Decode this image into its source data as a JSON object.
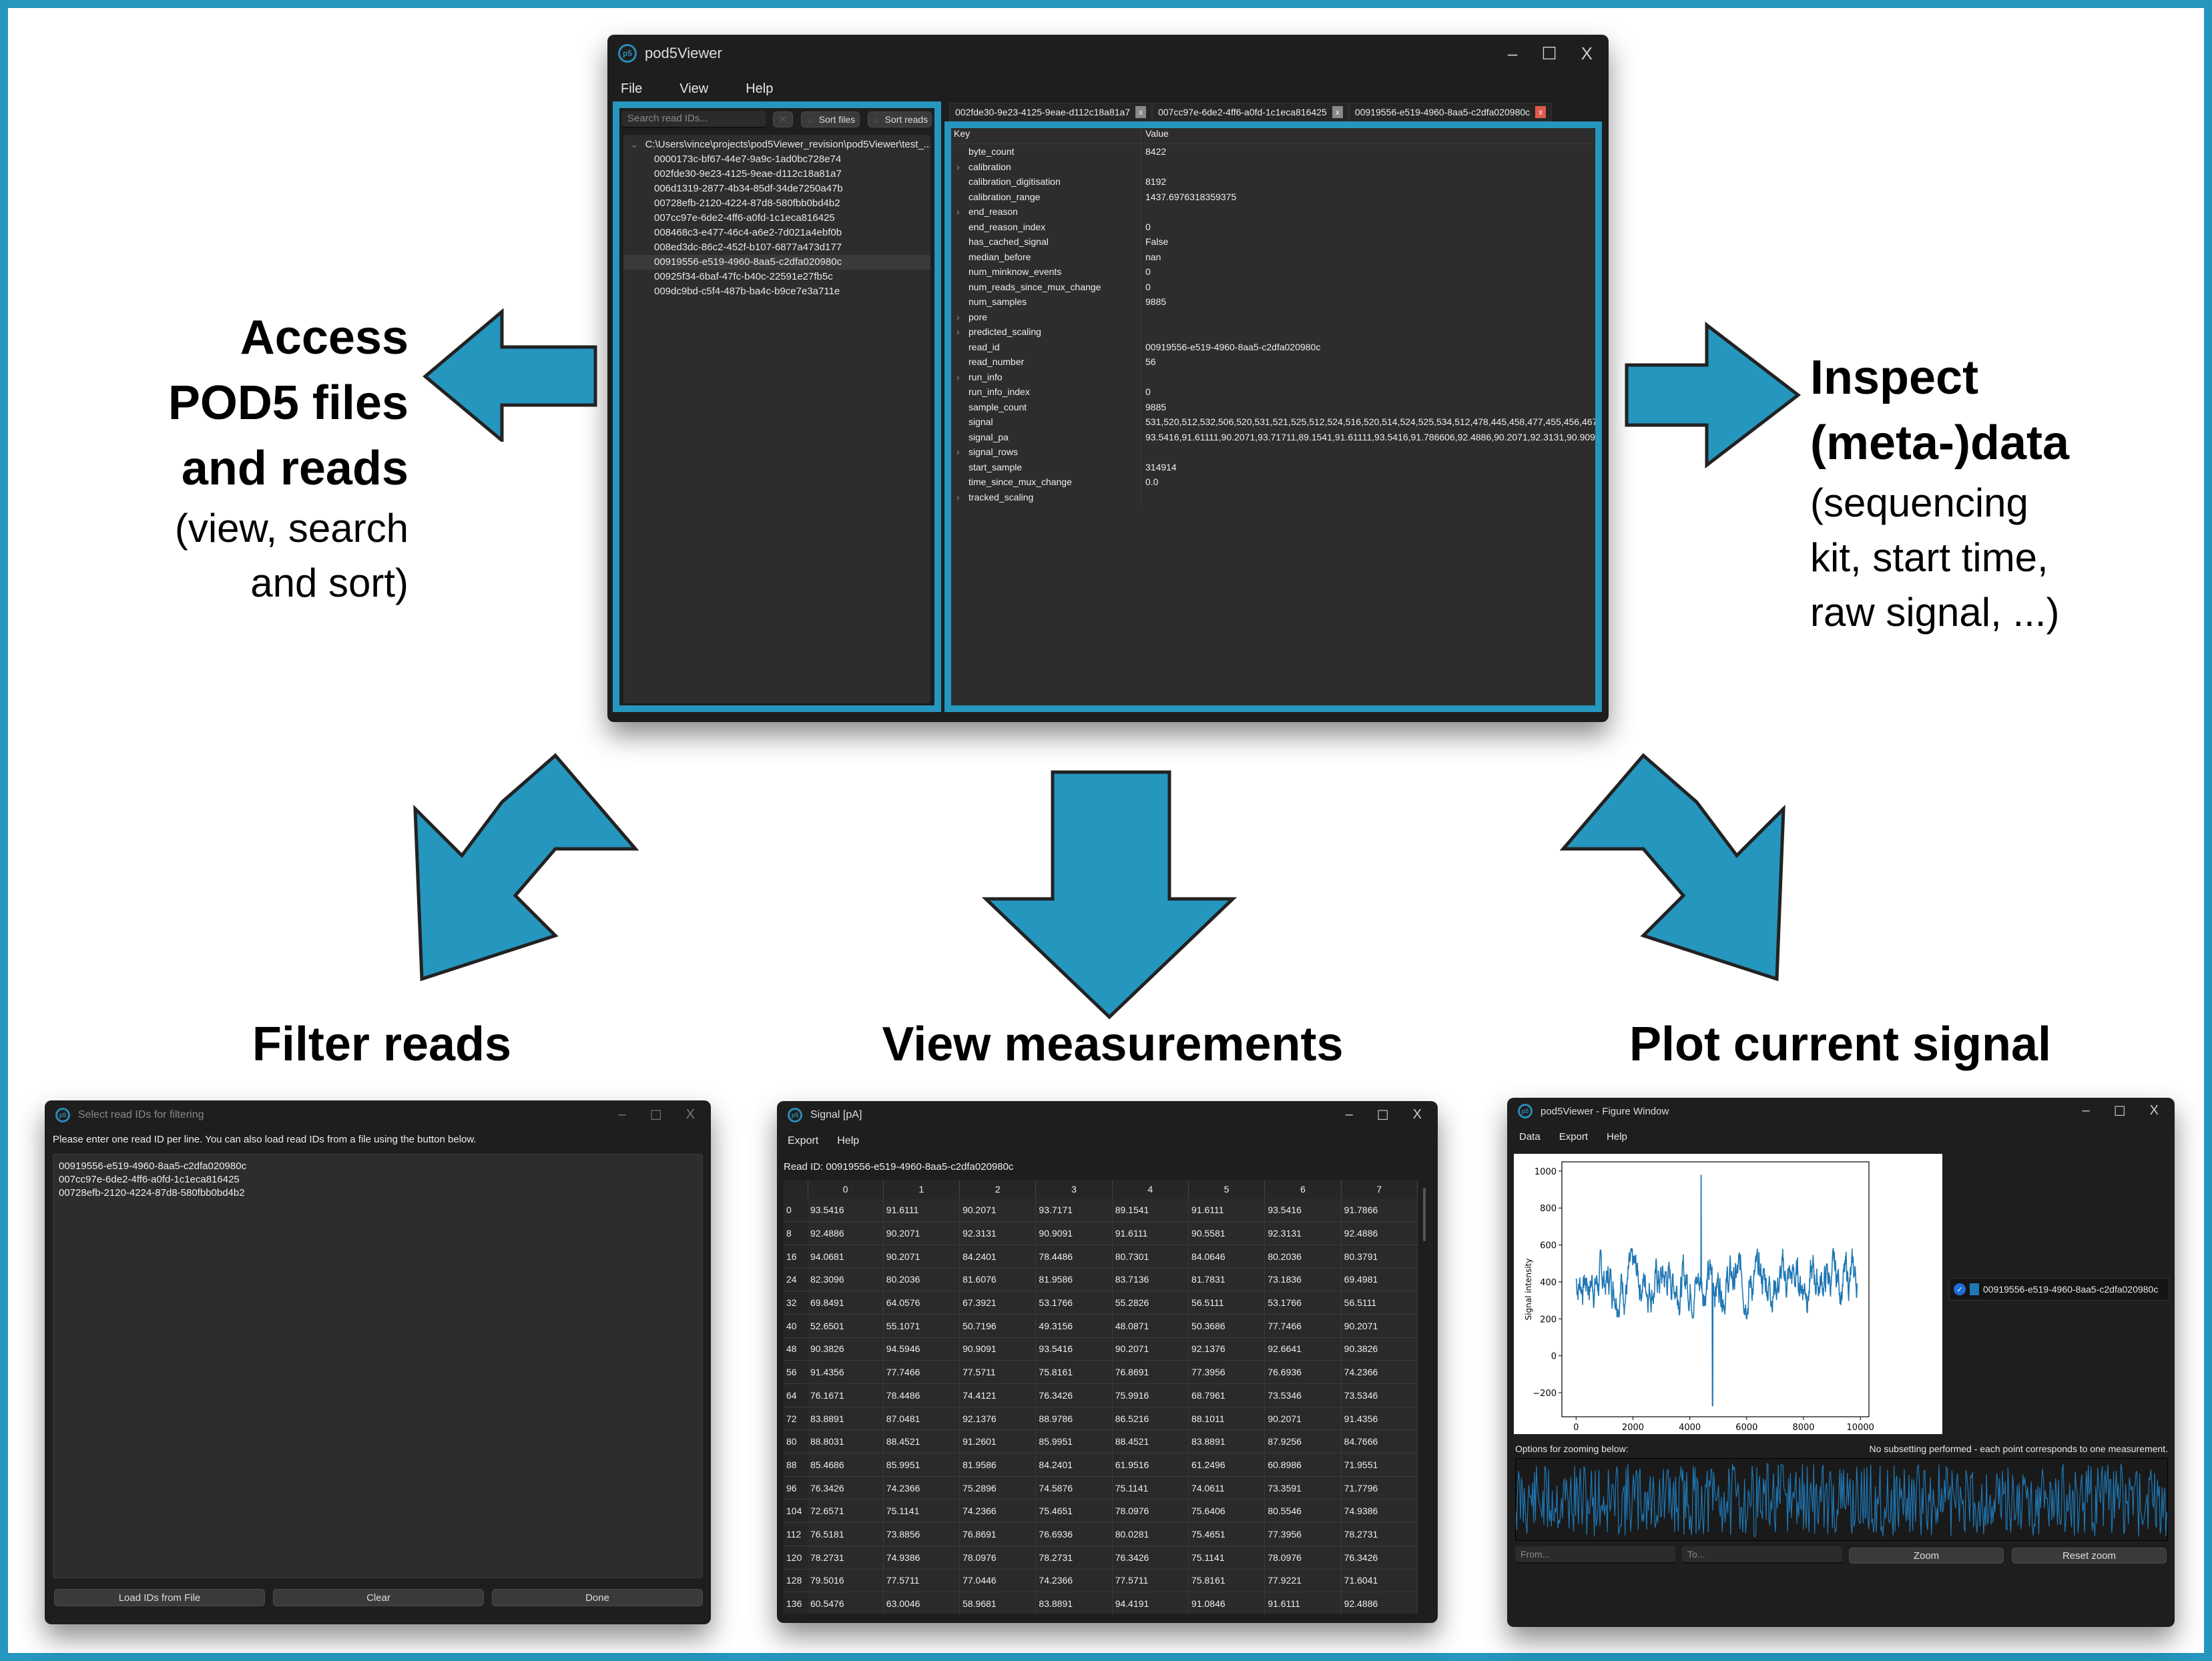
{
  "annotations": {
    "access": {
      "title": [
        "Access",
        "POD5 files",
        "and reads"
      ],
      "subtitle": [
        "(view, search",
        "and sort)"
      ]
    },
    "inspect": {
      "title": [
        "Inspect",
        "(meta-)data"
      ],
      "subtitle": [
        "(sequencing",
        "kit, start time,",
        "raw signal, ...)"
      ]
    },
    "captions": {
      "filter": "Filter reads",
      "measurements": "View measurements",
      "plot": "Plot current signal"
    }
  },
  "colors": {
    "accent": "#2596be",
    "window_bg": "#1e1e1e",
    "pane_bg": "#2d2d2d",
    "plot_line": "#1f77b4",
    "active_tab_close": "#e05a4a"
  },
  "main_window": {
    "title": "pod5Viewer",
    "menu": [
      "File",
      "View",
      "Help"
    ],
    "window_controls": {
      "minimize": "–",
      "maximize": "☐",
      "close": "X"
    },
    "search_placeholder": "Search read IDs...",
    "clear_search_icon": "✕",
    "sort_files_label": "Sort files",
    "sort_reads_label": "Sort reads",
    "file_path": "C:\\Users\\vince\\projects\\pod5Viewer_revision\\pod5Viewer\\test_...",
    "read_ids": [
      "0000173c-bf67-44e7-9a9c-1ad0bc728e74",
      "002fde30-9e23-4125-9eae-d112c18a81a7",
      "006d1319-2877-4b34-85df-34de7250a47b",
      "00728efb-2120-4224-87d8-580fbb0bd4b2",
      "007cc97e-6de2-4ff6-a0fd-1c1eca816425",
      "008468c3-e477-46c4-a6e2-7d021a4ebf0b",
      "008ed3dc-86c2-452f-b107-6877a473d177",
      "00919556-e519-4960-8aa5-c2dfa020980c",
      "00925f34-6baf-47fc-b40c-22591e27fb5c",
      "009dc9bd-c5f4-487b-ba4c-b9ce7e3a711e"
    ],
    "selected_read_index": 7,
    "tabs": [
      {
        "label": "002fde30-9e23-4125-9eae-d112c18a81a7",
        "active": false
      },
      {
        "label": "007cc97e-6de2-4ff6-a0fd-1c1eca816425",
        "active": false
      },
      {
        "label": "00919556-e519-4960-8aa5-c2dfa020980c",
        "active": true
      }
    ],
    "tab_close_label": "x",
    "kv_headers": {
      "key": "Key",
      "value": "Value"
    },
    "kv_rows": [
      {
        "key": "byte_count",
        "value": "8422",
        "expandable": false
      },
      {
        "key": "calibration",
        "value": "",
        "expandable": true
      },
      {
        "key": "calibration_digitisation",
        "value": "8192",
        "expandable": false
      },
      {
        "key": "calibration_range",
        "value": "1437.6976318359375",
        "expandable": false
      },
      {
        "key": "end_reason",
        "value": "",
        "expandable": true
      },
      {
        "key": "end_reason_index",
        "value": "0",
        "expandable": false
      },
      {
        "key": "has_cached_signal",
        "value": "False",
        "expandable": false
      },
      {
        "key": "median_before",
        "value": "nan",
        "expandable": false
      },
      {
        "key": "num_minknow_events",
        "value": "0",
        "expandable": false
      },
      {
        "key": "num_reads_since_mux_change",
        "value": "0",
        "expandable": false
      },
      {
        "key": "num_samples",
        "value": "9885",
        "expandable": false
      },
      {
        "key": "pore",
        "value": "",
        "expandable": true
      },
      {
        "key": "predicted_scaling",
        "value": "",
        "expandable": true
      },
      {
        "key": "read_id",
        "value": "00919556-e519-4960-8aa5-c2dfa020980c",
        "expandable": false
      },
      {
        "key": "read_number",
        "value": "56",
        "expandable": false
      },
      {
        "key": "run_info",
        "value": "",
        "expandable": true
      },
      {
        "key": "run_info_index",
        "value": "0",
        "expandable": false
      },
      {
        "key": "sample_count",
        "value": "9885",
        "expandable": false
      },
      {
        "key": "signal",
        "value": "531,520,512,532,506,520,531,521,525,512,524,516,520,514,524,525,534,512,478,445,458,477,455,456,467,...",
        "expandable": false
      },
      {
        "key": "signal_pa",
        "value": "93.5416,91.61111,90.2071,93.71711,89.1541,91.61111,93.5416,91.786606,92.4886,90.2071,92.3131,90.909...",
        "expandable": false
      },
      {
        "key": "signal_rows",
        "value": "",
        "expandable": true
      },
      {
        "key": "start_sample",
        "value": "314914",
        "expandable": false
      },
      {
        "key": "time_since_mux_change",
        "value": "0.0",
        "expandable": false
      },
      {
        "key": "tracked_scaling",
        "value": "",
        "expandable": true
      }
    ]
  },
  "filter_window": {
    "title": "Select read IDs for filtering",
    "instructions": "Please enter one read ID per line. You can also load read IDs from a file using the button below.",
    "textarea_lines": [
      "00919556-e519-4960-8aa5-c2dfa020980c",
      "007cc97e-6de2-4ff6-a0fd-1c1eca816425",
      "00728efb-2120-4224-87d8-580fbb0bd4b2"
    ],
    "buttons": {
      "load": "Load IDs from File",
      "clear": "Clear",
      "done": "Done"
    }
  },
  "signal_window": {
    "title": "Signal [pA]",
    "menu": [
      "Export",
      "Help"
    ],
    "read_id_label": "Read ID: 00919556-e519-4960-8aa5-c2dfa020980c",
    "columns": [
      "0",
      "1",
      "2",
      "3",
      "4",
      "5",
      "6",
      "7"
    ],
    "rows": [
      {
        "index": "0",
        "values": [
          "93.5416",
          "91.6111",
          "90.2071",
          "93.7171",
          "89.1541",
          "91.6111",
          "93.5416",
          "91.7866"
        ]
      },
      {
        "index": "8",
        "values": [
          "92.4886",
          "90.2071",
          "92.3131",
          "90.9091",
          "91.6111",
          "90.5581",
          "92.3131",
          "92.4886"
        ]
      },
      {
        "index": "16",
        "values": [
          "94.0681",
          "90.2071",
          "84.2401",
          "78.4486",
          "80.7301",
          "84.0646",
          "80.2036",
          "80.3791"
        ]
      },
      {
        "index": "24",
        "values": [
          "82.3096",
          "80.2036",
          "81.6076",
          "81.9586",
          "83.7136",
          "81.7831",
          "73.1836",
          "69.4981"
        ]
      },
      {
        "index": "32",
        "values": [
          "69.8491",
          "64.0576",
          "67.3921",
          "53.1766",
          "55.2826",
          "56.5111",
          "53.1766",
          "56.5111"
        ]
      },
      {
        "index": "40",
        "values": [
          "52.6501",
          "55.1071",
          "50.7196",
          "49.3156",
          "48.0871",
          "50.3686",
          "77.7466",
          "90.2071"
        ]
      },
      {
        "index": "48",
        "values": [
          "90.3826",
          "94.5946",
          "90.9091",
          "93.5416",
          "90.2071",
          "92.1376",
          "92.6641",
          "90.3826"
        ]
      },
      {
        "index": "56",
        "values": [
          "91.4356",
          "77.7466",
          "77.5711",
          "75.8161",
          "76.8691",
          "77.3956",
          "76.6936",
          "74.2366"
        ]
      },
      {
        "index": "64",
        "values": [
          "76.1671",
          "78.4486",
          "74.4121",
          "76.3426",
          "75.9916",
          "68.7961",
          "73.5346",
          "73.5346"
        ]
      },
      {
        "index": "72",
        "values": [
          "83.8891",
          "87.0481",
          "92.1376",
          "88.9786",
          "86.5216",
          "88.1011",
          "90.2071",
          "91.4356"
        ]
      },
      {
        "index": "80",
        "values": [
          "88.8031",
          "88.4521",
          "91.2601",
          "85.9951",
          "88.4521",
          "83.8891",
          "87.9256",
          "84.7666"
        ]
      },
      {
        "index": "88",
        "values": [
          "85.4686",
          "85.9951",
          "81.9586",
          "84.2401",
          "61.9516",
          "61.2496",
          "60.8986",
          "71.9551"
        ]
      },
      {
        "index": "96",
        "values": [
          "76.3426",
          "74.2366",
          "75.2896",
          "74.5876",
          "75.1141",
          "74.0611",
          "73.3591",
          "71.7796"
        ]
      },
      {
        "index": "104",
        "values": [
          "72.6571",
          "75.1141",
          "74.2366",
          "75.4651",
          "78.0976",
          "75.6406",
          "80.5546",
          "74.9386"
        ]
      },
      {
        "index": "112",
        "values": [
          "76.5181",
          "73.8856",
          "76.8691",
          "76.6936",
          "80.0281",
          "75.4651",
          "77.3956",
          "78.2731"
        ]
      },
      {
        "index": "120",
        "values": [
          "78.2731",
          "74.9386",
          "78.0976",
          "78.2731",
          "76.3426",
          "75.1141",
          "78.0976",
          "76.3426"
        ]
      },
      {
        "index": "128",
        "values": [
          "79.5016",
          "77.5711",
          "77.0446",
          "74.2366",
          "77.5711",
          "75.8161",
          "77.9221",
          "71.6041"
        ]
      },
      {
        "index": "136",
        "values": [
          "60.5476",
          "63.0046",
          "58.9681",
          "83.8891",
          "94.4191",
          "91.0846",
          "91.6111",
          "92.4886"
        ]
      }
    ]
  },
  "plot_window": {
    "title": "pod5Viewer - Figure Window",
    "menu": [
      "Data",
      "Export",
      "Help"
    ],
    "legend_label": "00919556-e519-4960-8aa5-c2dfa020980c",
    "legend_checked": true,
    "zoom_options_label": "Options for zooming below:",
    "subsetting_note": "No subsetting performed - each point corresponds to one measurement.",
    "from_placeholder": "From...",
    "to_placeholder": "To...",
    "zoom_button": "Zoom",
    "reset_zoom_button": "Reset zoom"
  },
  "chart_data": {
    "type": "line",
    "title": "",
    "xlabel": "",
    "ylabel": "Signal intensity",
    "xlim": [
      -500,
      10300
    ],
    "ylim": [
      -330,
      1050
    ],
    "xticks": [
      0,
      2000,
      4000,
      6000,
      8000,
      10000
    ],
    "yticks": [
      -200,
      0,
      200,
      400,
      600,
      800,
      1000
    ],
    "xtick_labels": [
      "0",
      "2000",
      "4000",
      "6000",
      "8000",
      "10000"
    ],
    "ytick_labels": [
      "−200",
      "0",
      "200",
      "400",
      "600",
      "800",
      "1000"
    ],
    "grid": false,
    "series": [
      {
        "name": "00919556-e519-4960-8aa5-c2dfa020980c",
        "n_points": 9885,
        "typical_range": [
          200,
          580
        ],
        "mean": 410,
        "spike_max": {
          "x": 4400,
          "y": 980
        },
        "spike_min": {
          "x": 4800,
          "y": -270
        }
      }
    ]
  }
}
